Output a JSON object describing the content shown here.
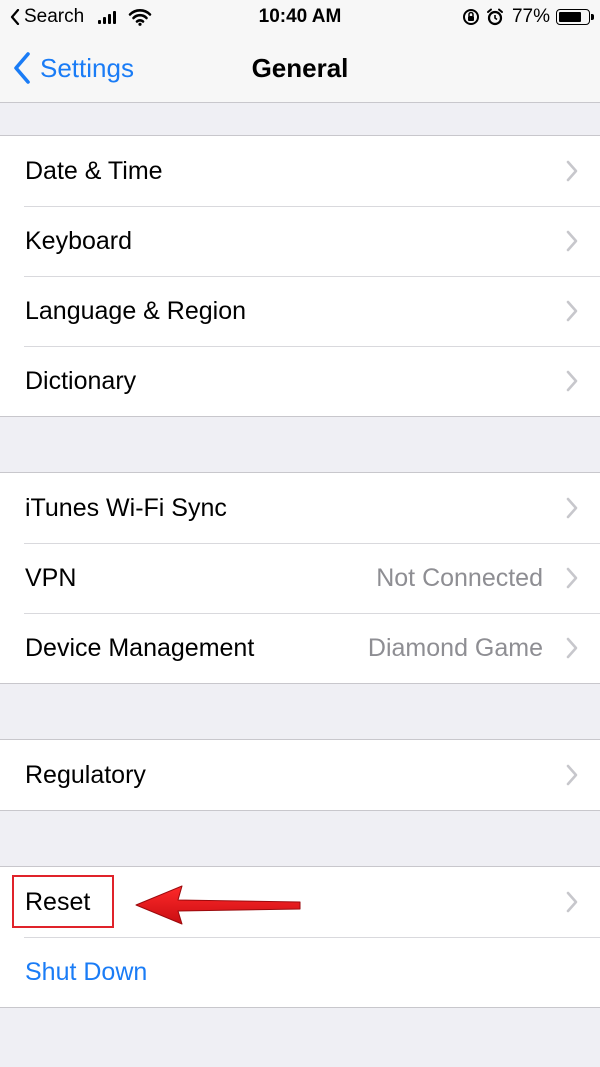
{
  "status_bar": {
    "back_app": "Search",
    "time": "10:40 AM",
    "battery_percent": "77%",
    "battery_level": 0.77,
    "signal_bars": 4
  },
  "nav": {
    "back_label": "Settings",
    "title": "General"
  },
  "groups": [
    {
      "rows": [
        {
          "label": "Date & Time"
        },
        {
          "label": "Keyboard"
        },
        {
          "label": "Language & Region"
        },
        {
          "label": "Dictionary"
        }
      ]
    },
    {
      "rows": [
        {
          "label": "iTunes Wi-Fi Sync"
        },
        {
          "label": "VPN",
          "value": "Not Connected"
        },
        {
          "label": "Device Management",
          "value": "Diamond Game"
        }
      ]
    },
    {
      "rows": [
        {
          "label": "Regulatory"
        }
      ]
    },
    {
      "rows": [
        {
          "label": "Reset"
        },
        {
          "label": "Shut Down"
        }
      ]
    }
  ],
  "colors": {
    "accent": "#1a7cf6",
    "annotation": "#e0232a",
    "background": "#efeff4"
  }
}
